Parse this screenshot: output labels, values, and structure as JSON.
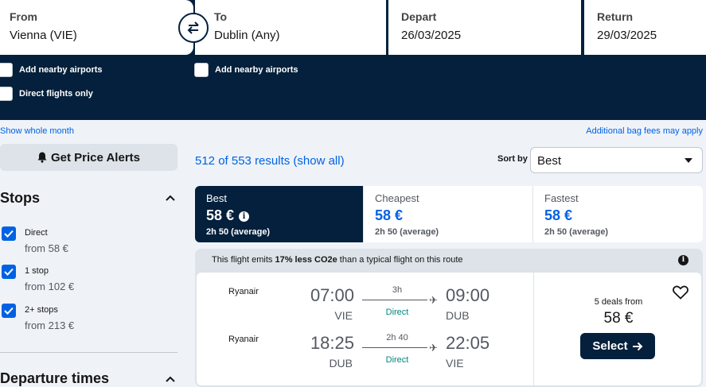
{
  "search": {
    "from": {
      "label": "From",
      "value": "Vienna (VIE)"
    },
    "to": {
      "label": "To",
      "value": "Dublin (Any)"
    },
    "depart": {
      "label": "Depart",
      "value": "26/03/2025"
    },
    "return": {
      "label": "Return",
      "value": "29/03/2025"
    },
    "nearby_from": "Add nearby airports",
    "nearby_to": "Add nearby airports",
    "direct_only": "Direct flights only"
  },
  "links": {
    "show_month": "Show whole month",
    "bag_fees": "Additional bag fees may apply"
  },
  "sidebar": {
    "price_alerts": "Get Price Alerts",
    "stops_title": "Stops",
    "stops": [
      {
        "label": "Direct",
        "price": "from 58 €"
      },
      {
        "label": "1 stop",
        "price": "from 102 €"
      },
      {
        "label": "2+ stops",
        "price": "from 213 €"
      }
    ],
    "departure_title": "Departure times"
  },
  "results": {
    "count": "512 of 553 results (show all)",
    "sort_label": "Sort by",
    "sort_value": "Best"
  },
  "tabs": [
    {
      "label": "Best",
      "price": "58 €",
      "avg": "2h 50 (average)"
    },
    {
      "label": "Cheapest",
      "price": "58 €",
      "avg": "2h 50 (average)"
    },
    {
      "label": "Fastest",
      "price": "58 €",
      "avg": "2h 50 (average)"
    }
  ],
  "card": {
    "eco_prefix": "This flight emits ",
    "eco_bold": "17% less CO2e",
    "eco_suffix": " than a typical flight on this route",
    "legs": [
      {
        "airline": "Ryanair",
        "dep_time": "07:00",
        "dep_code": "VIE",
        "duration": "3h",
        "stops": "Direct",
        "arr_time": "09:00",
        "arr_code": "DUB"
      },
      {
        "airline": "Ryanair",
        "dep_time": "18:25",
        "dep_code": "DUB",
        "duration": "2h 40",
        "stops": "Direct",
        "arr_time": "22:05",
        "arr_code": "VIE"
      }
    ],
    "deals": "5 deals from",
    "price": "58 €",
    "select": "Select"
  },
  "colors": {
    "navy": "#05203c",
    "blue": "#0062e3",
    "green": "#00877e"
  }
}
